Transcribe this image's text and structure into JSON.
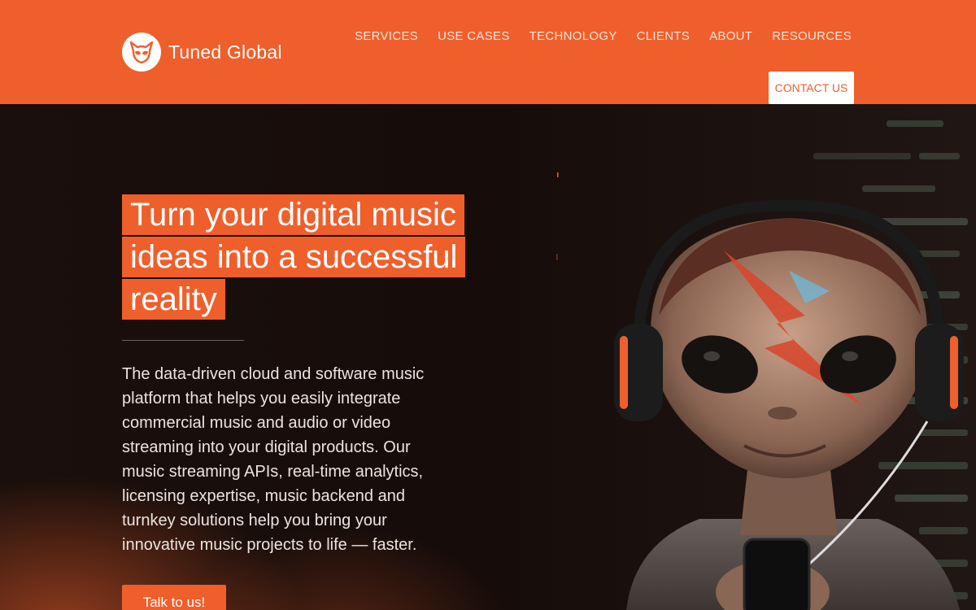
{
  "brand": {
    "name": "Tuned Global",
    "accent": "#ef5f2b"
  },
  "nav": {
    "items": [
      {
        "label": "SERVICES"
      },
      {
        "label": "USE CASES"
      },
      {
        "label": "TECHNOLOGY"
      },
      {
        "label": "CLIENTS"
      },
      {
        "label": "ABOUT"
      },
      {
        "label": "RESOURCES"
      }
    ],
    "contact_label": "CONTACT US"
  },
  "hero": {
    "headline_lines": [
      "Turn your digital music",
      "ideas into a successful",
      "reality"
    ],
    "description": "The data-driven cloud and software music platform that helps you easily integrate commercial music and audio or video streaming into your digital products. Our music streaming APIs, real-time analytics, licensing expertise, music backend and turnkey solutions help you bring your innovative music projects to life — faster.",
    "cta_label": "Talk to us!"
  },
  "icons": {
    "logo": "alien-head-icon"
  }
}
